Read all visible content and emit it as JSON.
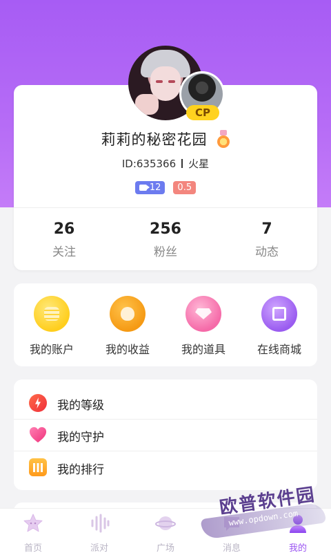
{
  "profile": {
    "nickname": "莉莉的秘密花园",
    "id_text": "ID:635366",
    "location": "火星",
    "cp_badge": "CP",
    "tags": {
      "video_count": "12",
      "level": "0.5"
    }
  },
  "stats": [
    {
      "value": "26",
      "label": "关注"
    },
    {
      "value": "256",
      "label": "粉丝"
    },
    {
      "value": "7",
      "label": "动态"
    }
  ],
  "menu": [
    {
      "label": "我的账户",
      "icon": "coins-icon"
    },
    {
      "label": "我的收益",
      "icon": "money-bag-icon"
    },
    {
      "label": "我的道具",
      "icon": "gem-icon"
    },
    {
      "label": "在线商城",
      "icon": "shopping-bag-icon"
    }
  ],
  "list": [
    {
      "label": "我的等级",
      "icon": "lightning-icon"
    },
    {
      "label": "我的守护",
      "icon": "heart-icon"
    },
    {
      "label": "我的排行",
      "icon": "bar-chart-icon"
    }
  ],
  "tabbar": [
    {
      "label": "首页",
      "icon": "star-icon"
    },
    {
      "label": "派对",
      "icon": "sound-wave-icon"
    },
    {
      "label": "广场",
      "icon": "planet-icon"
    },
    {
      "label": "消息",
      "icon": "message-icon"
    },
    {
      "label": "我的",
      "icon": "person-icon",
      "active": true
    }
  ],
  "colors": {
    "accent": "#9b55f2",
    "header": "#a75cf4"
  },
  "watermark": {
    "title": "欧普软件园",
    "url": "www.opdown.com"
  }
}
